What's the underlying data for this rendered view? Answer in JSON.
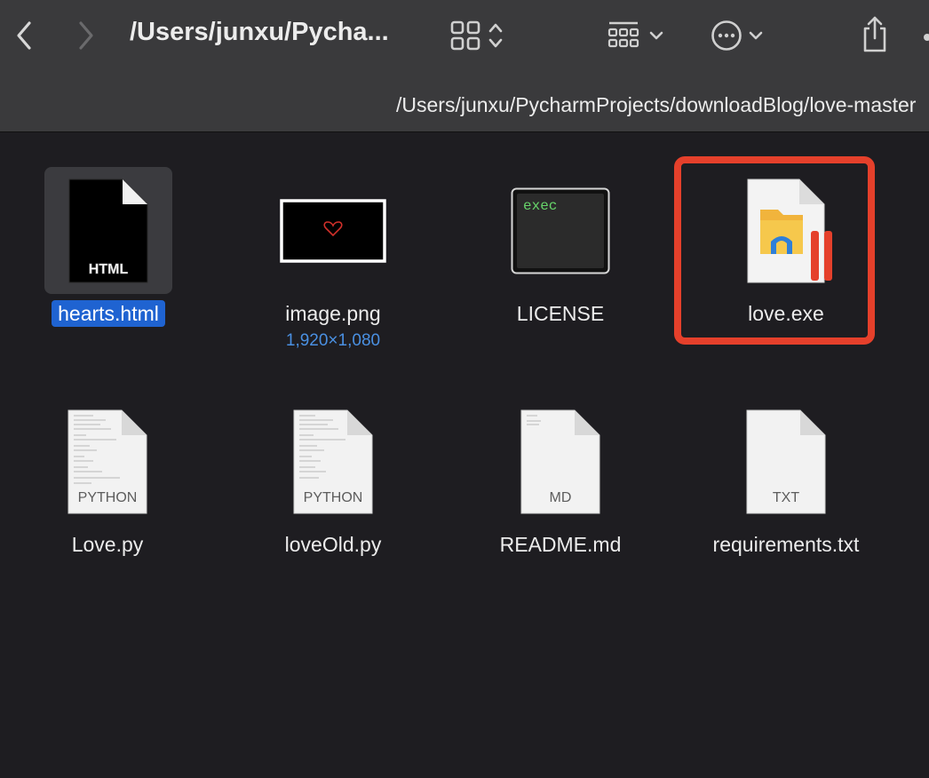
{
  "window": {
    "title": "/Users/junxu/Pycha...",
    "path": "/Users/junxu/PycharmProjects/downloadBlog/love-master"
  },
  "toolbar": {
    "back_icon": "chevron-left-icon",
    "forward_icon": "chevron-right-icon",
    "view_icon": "grid-view-icon",
    "group_icon": "group-by-icon",
    "more_icon": "ellipsis-circle-icon",
    "share_icon": "share-icon"
  },
  "files": [
    {
      "name": "hearts.html",
      "type_label": "HTML",
      "selected": true
    },
    {
      "name": "image.png",
      "meta": "1,920×1,080"
    },
    {
      "name": "LICENSE",
      "type_label": "exec"
    },
    {
      "name": "love.exe",
      "highlighted": true
    },
    {
      "name": "Love.py",
      "type_label": "PYTHON"
    },
    {
      "name": "loveOld.py",
      "type_label": "PYTHON"
    },
    {
      "name": "README.md",
      "type_label": "MD"
    },
    {
      "name": "requirements.txt",
      "type_label": "TXT"
    }
  ],
  "colors": {
    "toolbar": "#3a3a3c",
    "content_bg": "#1e1d21",
    "selection": "#1f63d1",
    "highlight": "#e5402b",
    "meta_text": "#4a90e2"
  }
}
